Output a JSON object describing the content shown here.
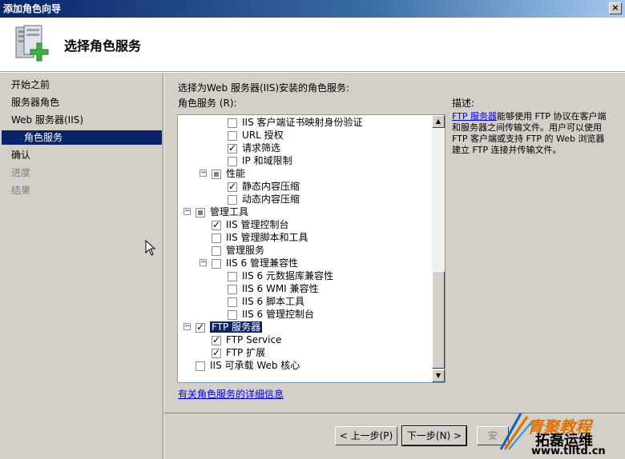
{
  "window": {
    "title": "添加角色向导",
    "close_label": "×"
  },
  "header": {
    "title": "选择角色服务",
    "icon": "server-add-icon"
  },
  "nav": {
    "items": [
      {
        "label": "开始之前",
        "state": "normal"
      },
      {
        "label": "服务器角色",
        "state": "normal"
      },
      {
        "label": "Web 服务器(IIS)",
        "state": "normal"
      },
      {
        "label": "角色服务",
        "state": "selected"
      },
      {
        "label": "确认",
        "state": "normal"
      },
      {
        "label": "进度",
        "state": "disabled"
      },
      {
        "label": "结果",
        "state": "disabled"
      }
    ]
  },
  "main": {
    "instruction": "选择为Web 服务器(IIS)安装的角色服务:",
    "list_label": "角色服务 (R):",
    "tree": [
      {
        "label": "IIS 客户端证书映射身份验证",
        "checked": false
      },
      {
        "label": "URL 授权",
        "checked": false
      },
      {
        "label": "请求筛选",
        "checked": true
      },
      {
        "label": "IP 和域限制",
        "checked": false
      },
      {
        "label": "性能",
        "checked": "partial",
        "expander": "⊟"
      },
      {
        "label": "静态内容压缩",
        "checked": true
      },
      {
        "label": "动态内容压缩",
        "checked": false
      },
      {
        "label": "管理工具",
        "checked": "partial",
        "expander": "⊟"
      },
      {
        "label": "IIS 管理控制台",
        "checked": true
      },
      {
        "label": "IIS 管理脚本和工具",
        "checked": false
      },
      {
        "label": "管理服务",
        "checked": false
      },
      {
        "label": "IIS 6 管理兼容性",
        "checked": false,
        "expander": "⊟"
      },
      {
        "label": "IIS 6 元数据库兼容性",
        "checked": false
      },
      {
        "label": "IIS 6 WMI 兼容性",
        "checked": false
      },
      {
        "label": "IIS 6 脚本工具",
        "checked": false
      },
      {
        "label": "IIS 6 管理控制台",
        "checked": false
      },
      {
        "label": "FTP 服务器",
        "checked": true,
        "expander": "⊟",
        "highlight": true
      },
      {
        "label": "FTP Service",
        "checked": true
      },
      {
        "label": "FTP 扩展",
        "checked": true
      },
      {
        "label": "IIS 可承载 Web 核心",
        "checked": false
      }
    ],
    "description_title": "描述:",
    "description_link": "FTP 服务器",
    "description_text": "能够使用 FTP 协议在客户端和服务器之间传输文件。用户可以使用 FTP 客户端或支持 FTP 的 Web 浏览器建立 FTP 连接并传输文件。",
    "more_info_link": "有关角色服务的详细信息"
  },
  "footer": {
    "prev_label": "< 上一步(P)",
    "next_label": "下一步(N) >",
    "install_label": "安"
  },
  "watermark": {
    "line1": "青聚教程",
    "line2": "拓磊运维",
    "line3": "www.tlltd.cn"
  }
}
